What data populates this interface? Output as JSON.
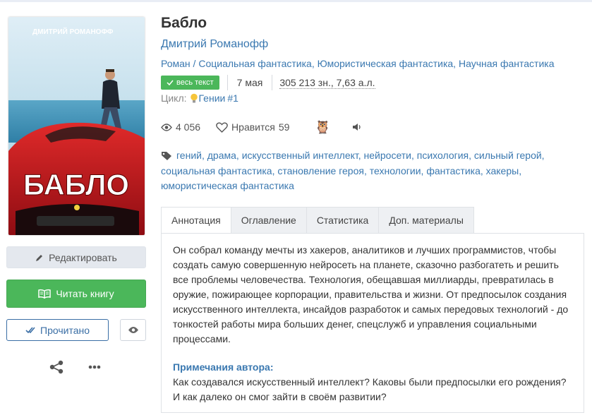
{
  "book": {
    "title": "Бабло",
    "author": "Дмитрий Романофф",
    "genres": [
      "Роман",
      "Социальная фантастика",
      "Юмористическая фантастика",
      "Научная фантастика"
    ],
    "badge": "весь текст",
    "date": "7 мая",
    "size": "305 213 зн., 7,63 а.л.",
    "cycle_label": "Цикл:",
    "cycle_name": "Гении",
    "cycle_num": "#1"
  },
  "cover": {
    "author_text": "ДМИТРИЙ РОМАНОФФ",
    "title_text": "БАБЛО"
  },
  "stats": {
    "views": "4 056",
    "likes_label": "Нравится",
    "likes": "59"
  },
  "tags": [
    "гений",
    "драма",
    "искусственный интеллект",
    "нейросети",
    "психология",
    "сильный герой",
    "социальная фантастика",
    "становление героя",
    "технологии",
    "фантастика",
    "хакеры",
    "юмористическая фантастика"
  ],
  "tabs": [
    "Аннотация",
    "Оглавление",
    "Статистика",
    "Доп. материалы"
  ],
  "annotation": "Он собрал команду мечты из хакеров, аналитиков и лучших программистов, чтобы создать самую совершенную нейросеть на планете, сказочно разбогатеть и решить все проблемы человечества. Технология, обещавшая миллиарды, превратилась в оружие, пожирающее корпорации, правительства и жизни. От предпосылок создания искусственного интеллекта, инсайдов разработок и самых передовых технологий - до тонкостей работы мира больших денег, спецслужб и управления социальными процессами.",
  "notes": {
    "title": "Примечания автора:",
    "text": "Как создавался искусственный интеллект? Каковы были предпосылки его рождения? И как далеко он смог зайти в своём развитии?"
  },
  "buttons": {
    "edit": "Редактировать",
    "read": "Читать книгу",
    "done": "Прочитано"
  },
  "colors": {
    "link": "#3a78b0",
    "green": "#4bb75a",
    "cover_red": "#c8141c"
  }
}
